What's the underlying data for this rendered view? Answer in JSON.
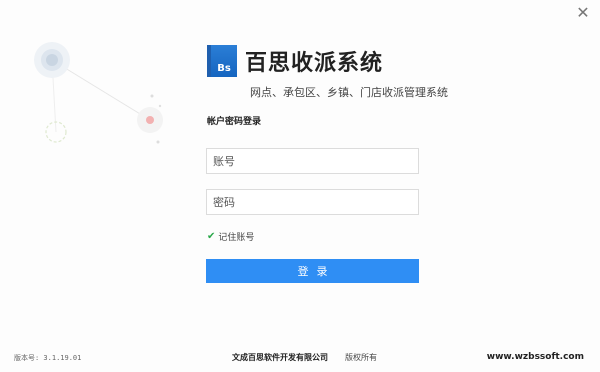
{
  "window": {
    "close_icon": "close-icon"
  },
  "brand": {
    "logo_text": "Bs",
    "title": "百思收派系统",
    "subtitle": "网点、承包区、乡镇、门店收派管理系统",
    "accent": "#1565c0"
  },
  "login": {
    "heading": "帐户密码登录",
    "account_placeholder": "账号",
    "password_placeholder": "密码",
    "remember_label": "记住账号",
    "remember_checked": true,
    "submit_label": "登录",
    "button_color": "#2f8ef4"
  },
  "footer": {
    "version": "版本号: 3.1.19.01",
    "company": "文成百思软件开发有限公司",
    "rights": "版权所有",
    "website": "www.wzbssoft.com"
  }
}
